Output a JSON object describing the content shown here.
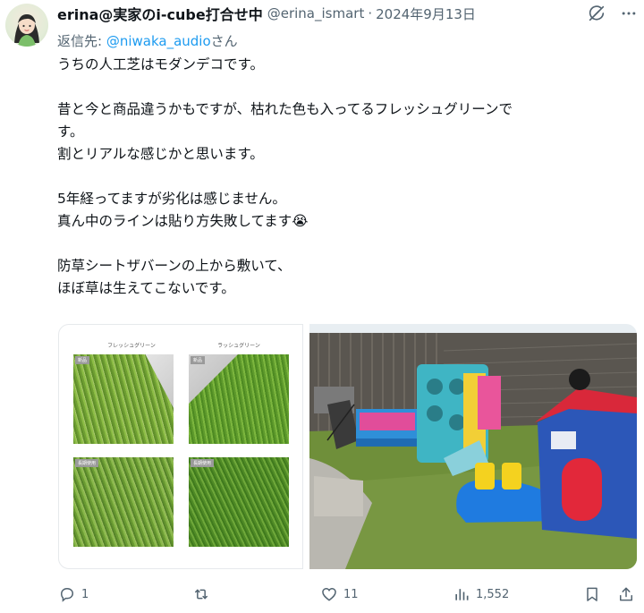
{
  "author": {
    "display_name": "erina@実家のi-cube打合せ中",
    "handle": "@erina_ismart",
    "date": "2024年9月13日"
  },
  "reply_to": {
    "prefix": "返信先: ",
    "user": "@niwaka_audio",
    "suffix": "さん"
  },
  "tweet": {
    "lines": [
      "うちの人工芝はモダンデコです。",
      "",
      "昔と今と商品違うかもですが、枯れた色も入ってるフレッシュグリーンで",
      "す。",
      "割とリアルな感じかと思います。",
      "",
      "5年経ってますが劣化は感じません。",
      "真ん中のラインは貼り方失敗してます😭",
      "",
      "防草シートザバーンの上から敷いて、",
      "ほぼ草は生えてこないです。"
    ]
  },
  "media": {
    "left": {
      "captions": [
        "フレッシュグリーン",
        "ラッシュグリーン"
      ],
      "tags": [
        "新品",
        "新品",
        "長期使用",
        "長期使用"
      ]
    }
  },
  "actions": {
    "replies": "1",
    "reposts": "",
    "likes": "11",
    "views": "1,552"
  },
  "icons": {
    "grok": "grok-icon",
    "more": "more-icon",
    "reply": "reply-icon",
    "repost": "repost-icon",
    "like": "heart-icon",
    "views": "views-icon",
    "bookmark": "bookmark-icon",
    "share": "share-icon"
  },
  "colors": {
    "link": "#1d9bf0",
    "muted": "#536471",
    "text": "#0f1419"
  }
}
